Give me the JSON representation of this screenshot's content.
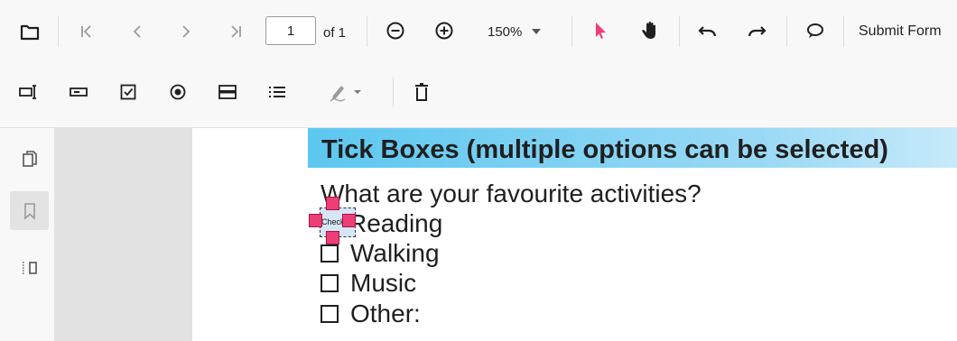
{
  "toolbar": {
    "page": {
      "current": "1",
      "of_label": "of 1"
    },
    "zoom": {
      "value": "150%"
    },
    "submit_label": "Submit Form",
    "icons": [
      "open-file-icon",
      "first-page-icon",
      "previous-page-icon",
      "next-page-icon",
      "last-page-icon",
      "zoom-out-icon",
      "zoom-in-icon",
      "dropdown-arrow-icon",
      "select-pointer-icon",
      "pan-hand-icon",
      "undo-icon",
      "redo-icon",
      "comment-icon",
      "textbox-field-icon",
      "password-field-icon",
      "checkbox-field-icon",
      "radio-button-field-icon",
      "dropdown-field-icon",
      "list-box-field-icon",
      "signature-field-icon",
      "delete-icon"
    ],
    "colors": {
      "accent": "#ef3e75",
      "icon": "#1f1f1f",
      "disabled": "#9a9a9a"
    }
  },
  "sidebar": {
    "items": [
      "page-thumbnails-icon",
      "bookmarks-icon",
      "form-fields-panel-icon"
    ]
  },
  "document": {
    "section_title": "Tick Boxes (multiple options can be selected)",
    "question": "What are your favourite activities?",
    "options": [
      "Reading",
      "Walking",
      "Music",
      "Other:"
    ],
    "selected_field_label": "Check",
    "colors": {
      "header_start": "#5cc7f0",
      "header_end": "#c7eafa",
      "field_fill": "#d6e6f7"
    }
  }
}
